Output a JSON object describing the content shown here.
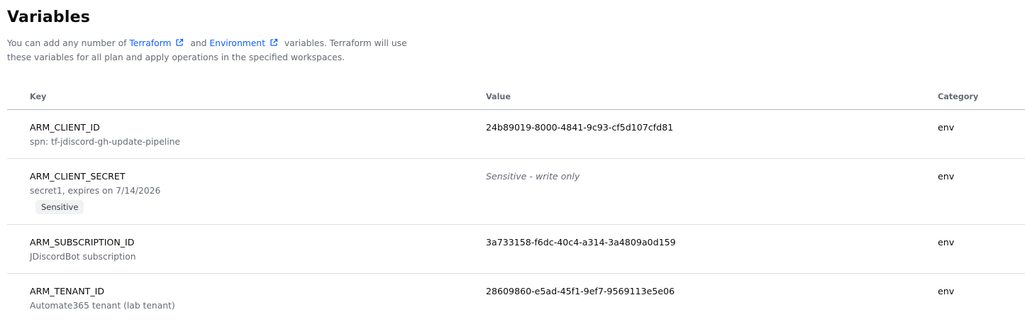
{
  "header": {
    "title": "Variables",
    "desc_part1": "You can add any number of ",
    "terraform_link": "Terraform",
    "desc_and": " and ",
    "environment_link": "Environment",
    "desc_part2": " variables. Terraform will use",
    "desc_line2": "these variables for all plan and apply operations in the specified workspaces."
  },
  "table": {
    "columns": {
      "key": "Key",
      "value": "Value",
      "category": "Category"
    },
    "rows": [
      {
        "key": "ARM_CLIENT_ID",
        "description": "spn: tf-jdiscord-gh-update-pipeline",
        "value": "24b89019-8000-4841-9c93-cf5d107cfd81",
        "category": "env"
      },
      {
        "key": "ARM_CLIENT_SECRET",
        "description": "secret1, expires on 7/14/2026",
        "badge": "Sensitive",
        "value": "Sensitive - write only",
        "category": "env"
      },
      {
        "key": "ARM_SUBSCRIPTION_ID",
        "description": "JDiscordBot subscription",
        "value": "3a733158-f6dc-40c4-a314-3a4809a0d159",
        "category": "env"
      },
      {
        "key": "ARM_TENANT_ID",
        "description": "Automate365 tenant (lab tenant)",
        "value": "28609860-e5ad-45f1-9ef7-9569113e5e06",
        "category": "env"
      }
    ]
  },
  "icons": {
    "external_link": "external-link-icon"
  },
  "colors": {
    "link": "#1060ff",
    "muted_text": "#656a76",
    "text": "#0c0c0e",
    "badge_bg": "#f1f2f3"
  }
}
